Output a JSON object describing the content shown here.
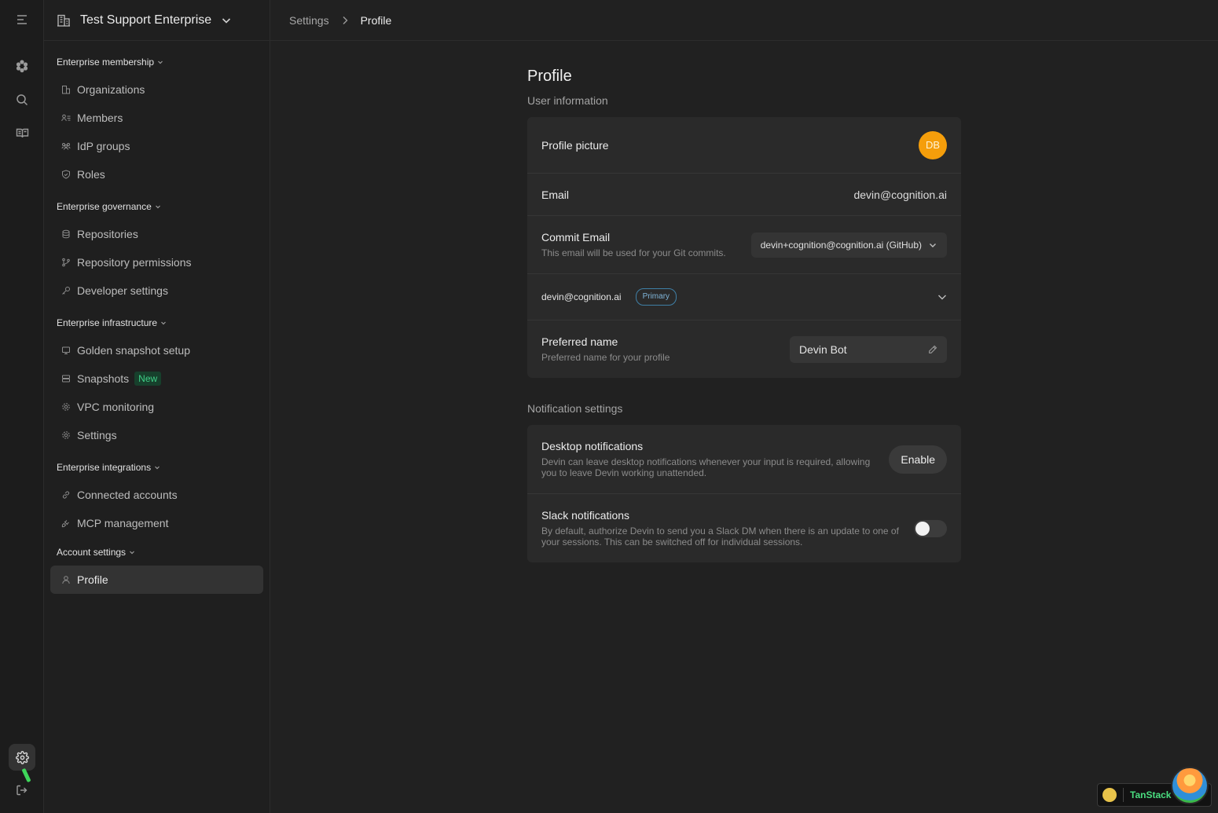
{
  "org": {
    "name": "Test Support Enterprise"
  },
  "breadcrumb": {
    "parent": "Settings",
    "current": "Profile"
  },
  "sidebar": {
    "sections": [
      {
        "title": "Enterprise membership",
        "items": [
          "Organizations",
          "Members",
          "IdP groups",
          "Roles"
        ]
      },
      {
        "title": "Enterprise governance",
        "items": [
          "Repositories",
          "Repository permissions",
          "Developer settings"
        ]
      },
      {
        "title": "Enterprise infrastructure",
        "items": [
          "Golden snapshot setup",
          "Snapshots",
          "VPC monitoring",
          "Settings"
        ],
        "snapshots_badge": "New"
      },
      {
        "title": "Enterprise integrations",
        "items": [
          "Connected accounts",
          "MCP management"
        ]
      },
      {
        "title": "Account settings",
        "items": [
          "Profile"
        ]
      }
    ]
  },
  "profile": {
    "title": "Profile",
    "user_info_title": "User information",
    "picture_label": "Profile picture",
    "avatar_initials": "DB",
    "avatar_color": "#f59e0b",
    "email_label": "Email",
    "email_value": "devin@cognition.ai",
    "commit_email_label": "Commit Email",
    "commit_email_sub": "This email will be used for your Git commits.",
    "commit_email_selected": "devin+cognition@cognition.ai (GitHub)",
    "emails_row_address": "devin@cognition.ai",
    "emails_row_badge": "Primary",
    "preferred_name_label": "Preferred name",
    "preferred_name_sub": "Preferred name for your profile",
    "preferred_name_value": "Devin Bot"
  },
  "notifications": {
    "title": "Notification settings",
    "desktop_label": "Desktop notifications",
    "desktop_sub": "Devin can leave desktop notifications whenever your input is required, allowing you to leave Devin working unattended.",
    "desktop_button": "Enable",
    "slack_label": "Slack notifications",
    "slack_sub": "By default, authorize Devin to send you a Slack DM when there is an update to one of your sessions. This can be switched off for individual sessions.",
    "slack_enabled": false
  },
  "devtools": {
    "label": "TanStack"
  }
}
